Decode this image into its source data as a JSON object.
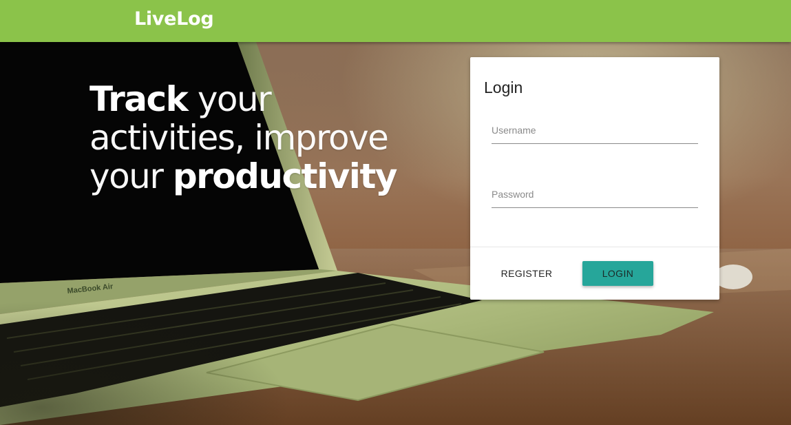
{
  "app_bar": {
    "title": "LiveLog"
  },
  "hero": {
    "headline": {
      "line1_bold": "Track",
      "line1_rest": "your",
      "line2": "activities, improve",
      "line3_start": "your",
      "line3_bold": "productivity"
    },
    "laptop_label": "MacBook Air"
  },
  "login": {
    "title": "Login",
    "username": {
      "placeholder": "Username",
      "value": ""
    },
    "password": {
      "placeholder": "Password",
      "value": ""
    },
    "register_label": "REGISTER",
    "login_label": "LOGIN"
  },
  "colors": {
    "app_bar": "#8bc34a",
    "login_button": "#26a69a"
  }
}
